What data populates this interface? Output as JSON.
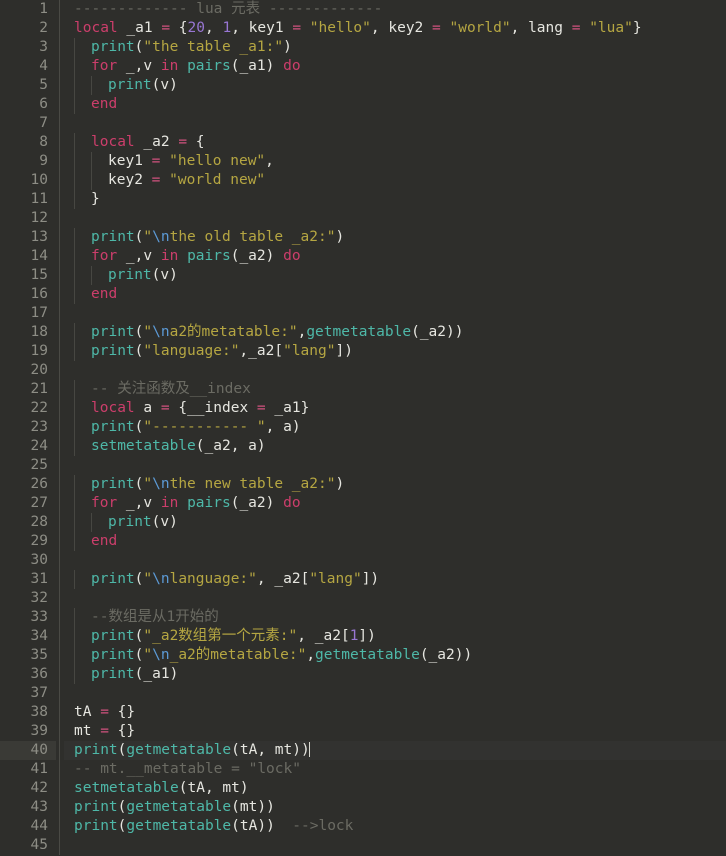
{
  "editor": {
    "language": "lua",
    "background": "#2e2e2b",
    "gutter_background": "#2e2e2b",
    "current_line": 40,
    "current_line_gutter_highlight": "#3a3a36",
    "total_lines_visible": 45,
    "colors": {
      "keyword": "#cc3e6b",
      "string": "#b5a642",
      "number": "#9876d3",
      "function": "#4eb8a8",
      "comment": "#6b6b63",
      "operator": "#d2527f",
      "escape": "#5c9ad6",
      "identifier": "#e6e6e0",
      "line_number": "#8d8d85"
    }
  },
  "lines": [
    {
      "n": "1",
      "indent": 0,
      "tokens": [
        {
          "c": "com",
          "t": "------------- lua 元表 -------------"
        }
      ]
    },
    {
      "n": "2",
      "indent": 0,
      "tokens": [
        {
          "c": "kw",
          "t": "local"
        },
        {
          "c": "id",
          "t": " _a1 "
        },
        {
          "c": "op",
          "t": "="
        },
        {
          "c": "id",
          "t": " "
        },
        {
          "c": "punc",
          "t": "{"
        },
        {
          "c": "num",
          "t": "20"
        },
        {
          "c": "punc",
          "t": ", "
        },
        {
          "c": "num",
          "t": "1"
        },
        {
          "c": "punc",
          "t": ", "
        },
        {
          "c": "id",
          "t": "key1 "
        },
        {
          "c": "op",
          "t": "="
        },
        {
          "c": "id",
          "t": " "
        },
        {
          "c": "str",
          "t": "\"hello\""
        },
        {
          "c": "punc",
          "t": ", "
        },
        {
          "c": "id",
          "t": "key2 "
        },
        {
          "c": "op",
          "t": "="
        },
        {
          "c": "id",
          "t": " "
        },
        {
          "c": "str",
          "t": "\"world\""
        },
        {
          "c": "punc",
          "t": ", "
        },
        {
          "c": "id",
          "t": "lang "
        },
        {
          "c": "op",
          "t": "="
        },
        {
          "c": "id",
          "t": " "
        },
        {
          "c": "str",
          "t": "\"lua\""
        },
        {
          "c": "punc",
          "t": "}"
        }
      ]
    },
    {
      "n": "3",
      "indent": 1,
      "tokens": [
        {
          "c": "fn",
          "t": "print"
        },
        {
          "c": "punc",
          "t": "("
        },
        {
          "c": "str",
          "t": "\"the table _a1:\""
        },
        {
          "c": "punc",
          "t": ")"
        }
      ]
    },
    {
      "n": "4",
      "indent": 1,
      "tokens": [
        {
          "c": "kw",
          "t": "for"
        },
        {
          "c": "id",
          "t": " _,v "
        },
        {
          "c": "kw",
          "t": "in"
        },
        {
          "c": "id",
          "t": " "
        },
        {
          "c": "fn",
          "t": "pairs"
        },
        {
          "c": "punc",
          "t": "("
        },
        {
          "c": "id",
          "t": "_a1"
        },
        {
          "c": "punc",
          "t": ")"
        },
        {
          "c": "id",
          "t": " "
        },
        {
          "c": "kw",
          "t": "do"
        }
      ]
    },
    {
      "n": "5",
      "indent": 2,
      "tokens": [
        {
          "c": "fn",
          "t": "print"
        },
        {
          "c": "punc",
          "t": "("
        },
        {
          "c": "id",
          "t": "v"
        },
        {
          "c": "punc",
          "t": ")"
        }
      ]
    },
    {
      "n": "6",
      "indent": 1,
      "tokens": [
        {
          "c": "kw",
          "t": "end"
        }
      ]
    },
    {
      "n": "7",
      "indent": 0,
      "tokens": []
    },
    {
      "n": "8",
      "indent": 1,
      "tokens": [
        {
          "c": "kw",
          "t": "local"
        },
        {
          "c": "id",
          "t": " _a2 "
        },
        {
          "c": "op",
          "t": "="
        },
        {
          "c": "id",
          "t": " "
        },
        {
          "c": "punc",
          "t": "{"
        }
      ]
    },
    {
      "n": "9",
      "indent": 2,
      "tokens": [
        {
          "c": "id",
          "t": "key1 "
        },
        {
          "c": "op",
          "t": "="
        },
        {
          "c": "id",
          "t": " "
        },
        {
          "c": "str",
          "t": "\"hello new\""
        },
        {
          "c": "punc",
          "t": ","
        }
      ]
    },
    {
      "n": "10",
      "indent": 2,
      "tokens": [
        {
          "c": "id",
          "t": "key2 "
        },
        {
          "c": "op",
          "t": "="
        },
        {
          "c": "id",
          "t": " "
        },
        {
          "c": "str",
          "t": "\"world new\""
        }
      ]
    },
    {
      "n": "11",
      "indent": 1,
      "tokens": [
        {
          "c": "punc",
          "t": "}"
        }
      ]
    },
    {
      "n": "12",
      "indent": 0,
      "tokens": []
    },
    {
      "n": "13",
      "indent": 1,
      "tokens": [
        {
          "c": "fn",
          "t": "print"
        },
        {
          "c": "punc",
          "t": "("
        },
        {
          "c": "str",
          "t": "\""
        },
        {
          "c": "esc",
          "t": "\\n"
        },
        {
          "c": "str",
          "t": "the old table _a2:\""
        },
        {
          "c": "punc",
          "t": ")"
        }
      ]
    },
    {
      "n": "14",
      "indent": 1,
      "tokens": [
        {
          "c": "kw",
          "t": "for"
        },
        {
          "c": "id",
          "t": " _,v "
        },
        {
          "c": "kw",
          "t": "in"
        },
        {
          "c": "id",
          "t": " "
        },
        {
          "c": "fn",
          "t": "pairs"
        },
        {
          "c": "punc",
          "t": "("
        },
        {
          "c": "id",
          "t": "_a2"
        },
        {
          "c": "punc",
          "t": ")"
        },
        {
          "c": "id",
          "t": " "
        },
        {
          "c": "kw",
          "t": "do"
        }
      ]
    },
    {
      "n": "15",
      "indent": 2,
      "tokens": [
        {
          "c": "fn",
          "t": "print"
        },
        {
          "c": "punc",
          "t": "("
        },
        {
          "c": "id",
          "t": "v"
        },
        {
          "c": "punc",
          "t": ")"
        }
      ]
    },
    {
      "n": "16",
      "indent": 1,
      "tokens": [
        {
          "c": "kw",
          "t": "end"
        }
      ]
    },
    {
      "n": "17",
      "indent": 0,
      "tokens": []
    },
    {
      "n": "18",
      "indent": 1,
      "tokens": [
        {
          "c": "fn",
          "t": "print"
        },
        {
          "c": "punc",
          "t": "("
        },
        {
          "c": "str",
          "t": "\""
        },
        {
          "c": "esc",
          "t": "\\n"
        },
        {
          "c": "str",
          "t": "a2的metatable:\""
        },
        {
          "c": "punc",
          "t": ","
        },
        {
          "c": "fn",
          "t": "getmetatable"
        },
        {
          "c": "punc",
          "t": "("
        },
        {
          "c": "id",
          "t": "_a2"
        },
        {
          "c": "punc",
          "t": "))"
        }
      ]
    },
    {
      "n": "19",
      "indent": 1,
      "tokens": [
        {
          "c": "fn",
          "t": "print"
        },
        {
          "c": "punc",
          "t": "("
        },
        {
          "c": "str",
          "t": "\"language:\""
        },
        {
          "c": "punc",
          "t": ","
        },
        {
          "c": "id",
          "t": "_a2"
        },
        {
          "c": "punc",
          "t": "["
        },
        {
          "c": "str",
          "t": "\"lang\""
        },
        {
          "c": "punc",
          "t": "])"
        }
      ]
    },
    {
      "n": "20",
      "indent": 0,
      "tokens": []
    },
    {
      "n": "21",
      "indent": 1,
      "tokens": [
        {
          "c": "com",
          "t": "-- 关注函数及__index"
        }
      ]
    },
    {
      "n": "22",
      "indent": 1,
      "tokens": [
        {
          "c": "kw",
          "t": "local"
        },
        {
          "c": "id",
          "t": " a "
        },
        {
          "c": "op",
          "t": "="
        },
        {
          "c": "id",
          "t": " "
        },
        {
          "c": "punc",
          "t": "{"
        },
        {
          "c": "id",
          "t": "__index "
        },
        {
          "c": "op",
          "t": "="
        },
        {
          "c": "id",
          "t": " _a1"
        },
        {
          "c": "punc",
          "t": "}"
        }
      ]
    },
    {
      "n": "23",
      "indent": 1,
      "tokens": [
        {
          "c": "fn",
          "t": "print"
        },
        {
          "c": "punc",
          "t": "("
        },
        {
          "c": "str",
          "t": "\"----------- \""
        },
        {
          "c": "punc",
          "t": ", "
        },
        {
          "c": "id",
          "t": "a"
        },
        {
          "c": "punc",
          "t": ")"
        }
      ]
    },
    {
      "n": "24",
      "indent": 1,
      "tokens": [
        {
          "c": "fn",
          "t": "setmetatable"
        },
        {
          "c": "punc",
          "t": "("
        },
        {
          "c": "id",
          "t": "_a2, a"
        },
        {
          "c": "punc",
          "t": ")"
        }
      ]
    },
    {
      "n": "25",
      "indent": 0,
      "tokens": []
    },
    {
      "n": "26",
      "indent": 1,
      "tokens": [
        {
          "c": "fn",
          "t": "print"
        },
        {
          "c": "punc",
          "t": "("
        },
        {
          "c": "str",
          "t": "\""
        },
        {
          "c": "esc",
          "t": "\\n"
        },
        {
          "c": "str",
          "t": "the new table _a2:\""
        },
        {
          "c": "punc",
          "t": ")"
        }
      ]
    },
    {
      "n": "27",
      "indent": 1,
      "tokens": [
        {
          "c": "kw",
          "t": "for"
        },
        {
          "c": "id",
          "t": " _,v "
        },
        {
          "c": "kw",
          "t": "in"
        },
        {
          "c": "id",
          "t": " "
        },
        {
          "c": "fn",
          "t": "pairs"
        },
        {
          "c": "punc",
          "t": "("
        },
        {
          "c": "id",
          "t": "_a2"
        },
        {
          "c": "punc",
          "t": ")"
        },
        {
          "c": "id",
          "t": " "
        },
        {
          "c": "kw",
          "t": "do"
        }
      ]
    },
    {
      "n": "28",
      "indent": 2,
      "tokens": [
        {
          "c": "fn",
          "t": "print"
        },
        {
          "c": "punc",
          "t": "("
        },
        {
          "c": "id",
          "t": "v"
        },
        {
          "c": "punc",
          "t": ")"
        }
      ]
    },
    {
      "n": "29",
      "indent": 1,
      "tokens": [
        {
          "c": "kw",
          "t": "end"
        }
      ]
    },
    {
      "n": "30",
      "indent": 0,
      "tokens": []
    },
    {
      "n": "31",
      "indent": 1,
      "tokens": [
        {
          "c": "fn",
          "t": "print"
        },
        {
          "c": "punc",
          "t": "("
        },
        {
          "c": "str",
          "t": "\""
        },
        {
          "c": "esc",
          "t": "\\n"
        },
        {
          "c": "str",
          "t": "language:\""
        },
        {
          "c": "punc",
          "t": ", "
        },
        {
          "c": "id",
          "t": "_a2"
        },
        {
          "c": "punc",
          "t": "["
        },
        {
          "c": "str",
          "t": "\"lang\""
        },
        {
          "c": "punc",
          "t": "])"
        }
      ]
    },
    {
      "n": "32",
      "indent": 0,
      "tokens": []
    },
    {
      "n": "33",
      "indent": 1,
      "tokens": [
        {
          "c": "com",
          "t": "--数组是从1开始的"
        }
      ]
    },
    {
      "n": "34",
      "indent": 1,
      "tokens": [
        {
          "c": "fn",
          "t": "print"
        },
        {
          "c": "punc",
          "t": "("
        },
        {
          "c": "str",
          "t": "\"_a2数组第一个元素:\""
        },
        {
          "c": "punc",
          "t": ", "
        },
        {
          "c": "id",
          "t": "_a2"
        },
        {
          "c": "punc",
          "t": "["
        },
        {
          "c": "num",
          "t": "1"
        },
        {
          "c": "punc",
          "t": "])"
        }
      ]
    },
    {
      "n": "35",
      "indent": 1,
      "tokens": [
        {
          "c": "fn",
          "t": "print"
        },
        {
          "c": "punc",
          "t": "("
        },
        {
          "c": "str",
          "t": "\""
        },
        {
          "c": "esc",
          "t": "\\n"
        },
        {
          "c": "str",
          "t": "_a2的metatable:\""
        },
        {
          "c": "punc",
          "t": ","
        },
        {
          "c": "fn",
          "t": "getmetatable"
        },
        {
          "c": "punc",
          "t": "("
        },
        {
          "c": "id",
          "t": "_a2"
        },
        {
          "c": "punc",
          "t": "))"
        }
      ]
    },
    {
      "n": "36",
      "indent": 1,
      "tokens": [
        {
          "c": "fn",
          "t": "print"
        },
        {
          "c": "punc",
          "t": "("
        },
        {
          "c": "id",
          "t": "_a1"
        },
        {
          "c": "punc",
          "t": ")"
        }
      ]
    },
    {
      "n": "37",
      "indent": 0,
      "tokens": []
    },
    {
      "n": "38",
      "indent": 0,
      "tokens": [
        {
          "c": "id",
          "t": "tA "
        },
        {
          "c": "op",
          "t": "="
        },
        {
          "c": "id",
          "t": " "
        },
        {
          "c": "punc",
          "t": "{}"
        }
      ]
    },
    {
      "n": "39",
      "indent": 0,
      "tokens": [
        {
          "c": "id",
          "t": "mt "
        },
        {
          "c": "op",
          "t": "="
        },
        {
          "c": "id",
          "t": " "
        },
        {
          "c": "punc",
          "t": "{}"
        }
      ]
    },
    {
      "n": "40",
      "indent": 0,
      "current": true,
      "caret": true,
      "tokens": [
        {
          "c": "fn",
          "t": "print"
        },
        {
          "c": "punc",
          "t": "("
        },
        {
          "c": "fn",
          "t": "getmetatable"
        },
        {
          "c": "punc",
          "t": "("
        },
        {
          "c": "id",
          "t": "tA, mt"
        },
        {
          "c": "punc",
          "t": "))"
        }
      ]
    },
    {
      "n": "41",
      "indent": 0,
      "tokens": [
        {
          "c": "com",
          "t": "-- mt.__metatable = \"lock\""
        }
      ]
    },
    {
      "n": "42",
      "indent": 0,
      "tokens": [
        {
          "c": "fn",
          "t": "setmetatable"
        },
        {
          "c": "punc",
          "t": "("
        },
        {
          "c": "id",
          "t": "tA, mt"
        },
        {
          "c": "punc",
          "t": ")"
        }
      ]
    },
    {
      "n": "43",
      "indent": 0,
      "tokens": [
        {
          "c": "fn",
          "t": "print"
        },
        {
          "c": "punc",
          "t": "("
        },
        {
          "c": "fn",
          "t": "getmetatable"
        },
        {
          "c": "punc",
          "t": "("
        },
        {
          "c": "id",
          "t": "mt"
        },
        {
          "c": "punc",
          "t": "))"
        }
      ]
    },
    {
      "n": "44",
      "indent": 0,
      "tokens": [
        {
          "c": "fn",
          "t": "print"
        },
        {
          "c": "punc",
          "t": "("
        },
        {
          "c": "fn",
          "t": "getmetatable"
        },
        {
          "c": "punc",
          "t": "("
        },
        {
          "c": "id",
          "t": "tA"
        },
        {
          "c": "punc",
          "t": "))"
        },
        {
          "c": "com",
          "t": "  -->lock"
        }
      ]
    },
    {
      "n": "45",
      "indent": 0,
      "tokens": []
    }
  ]
}
